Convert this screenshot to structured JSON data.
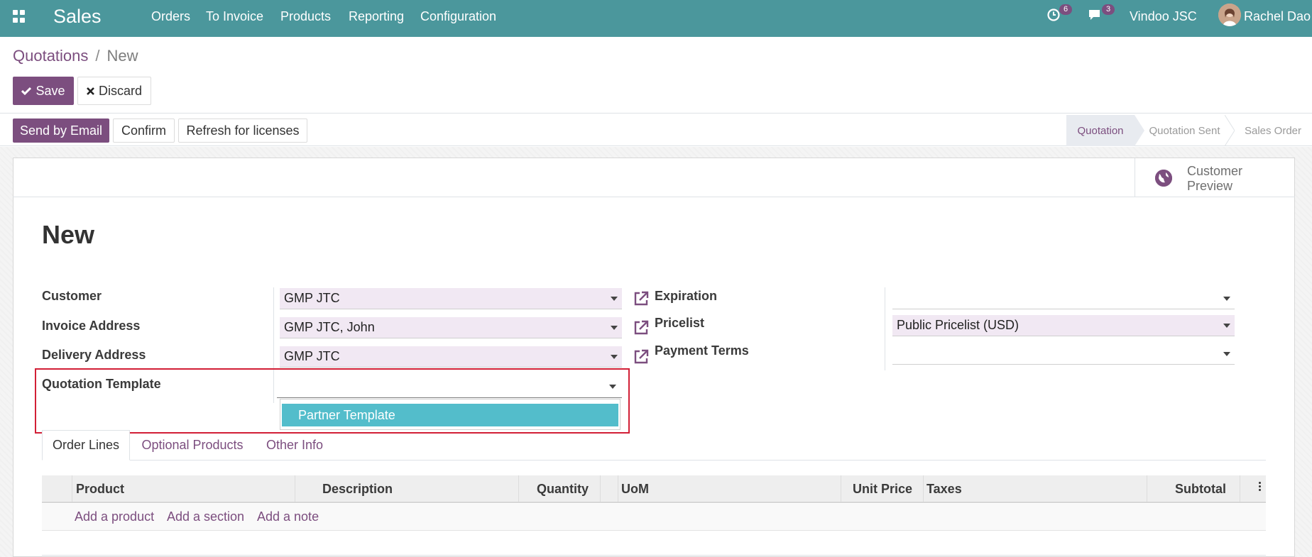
{
  "navbar": {
    "app_name": "Sales",
    "menu": [
      "Orders",
      "To Invoice",
      "Products",
      "Reporting",
      "Configuration"
    ],
    "activity_count": "6",
    "message_count": "3",
    "company": "Vindoo JSC",
    "user": "Rachel Dao"
  },
  "breadcrumb": {
    "parent": "Quotations",
    "separator": "/",
    "current": "New"
  },
  "actions": {
    "save": "Save",
    "discard": "Discard"
  },
  "statusbar": {
    "buttons": [
      "Send by Email",
      "Confirm",
      "Refresh for licenses"
    ],
    "stages": [
      "Quotation",
      "Quotation Sent",
      "Sales Order"
    ],
    "active_stage": "Quotation"
  },
  "button_box": {
    "preview_line1": "Customer",
    "preview_line2": "Preview"
  },
  "form": {
    "title": "New",
    "customer_label": "Customer",
    "customer_value": "GMP JTC",
    "invoice_address_label": "Invoice Address",
    "invoice_address_value": "GMP JTC, John",
    "delivery_address_label": "Delivery Address",
    "delivery_address_value": "GMP JTC",
    "quotation_template_label": "Quotation Template",
    "quotation_template_value": "",
    "expiration_label": "Expiration",
    "expiration_value": "",
    "pricelist_label": "Pricelist",
    "pricelist_value": "Public Pricelist (USD)",
    "payment_terms_label": "Payment Terms",
    "payment_terms_value": ""
  },
  "dropdown": {
    "options": [
      "Partner Template"
    ],
    "highlighted": "Partner Template"
  },
  "tabs": [
    "Order Lines",
    "Optional Products",
    "Other Info"
  ],
  "table": {
    "columns": [
      "Product",
      "Description",
      "Quantity",
      "UoM",
      "Unit Price",
      "Taxes",
      "Subtotal"
    ],
    "add_links": [
      "Add a product",
      "Add a section",
      "Add a note"
    ]
  },
  "colors": {
    "navbar": "#4b979c",
    "primary": "#7c4e7f",
    "highlight_box": "#d21f36",
    "dropdown_active": "#53bdcb"
  }
}
